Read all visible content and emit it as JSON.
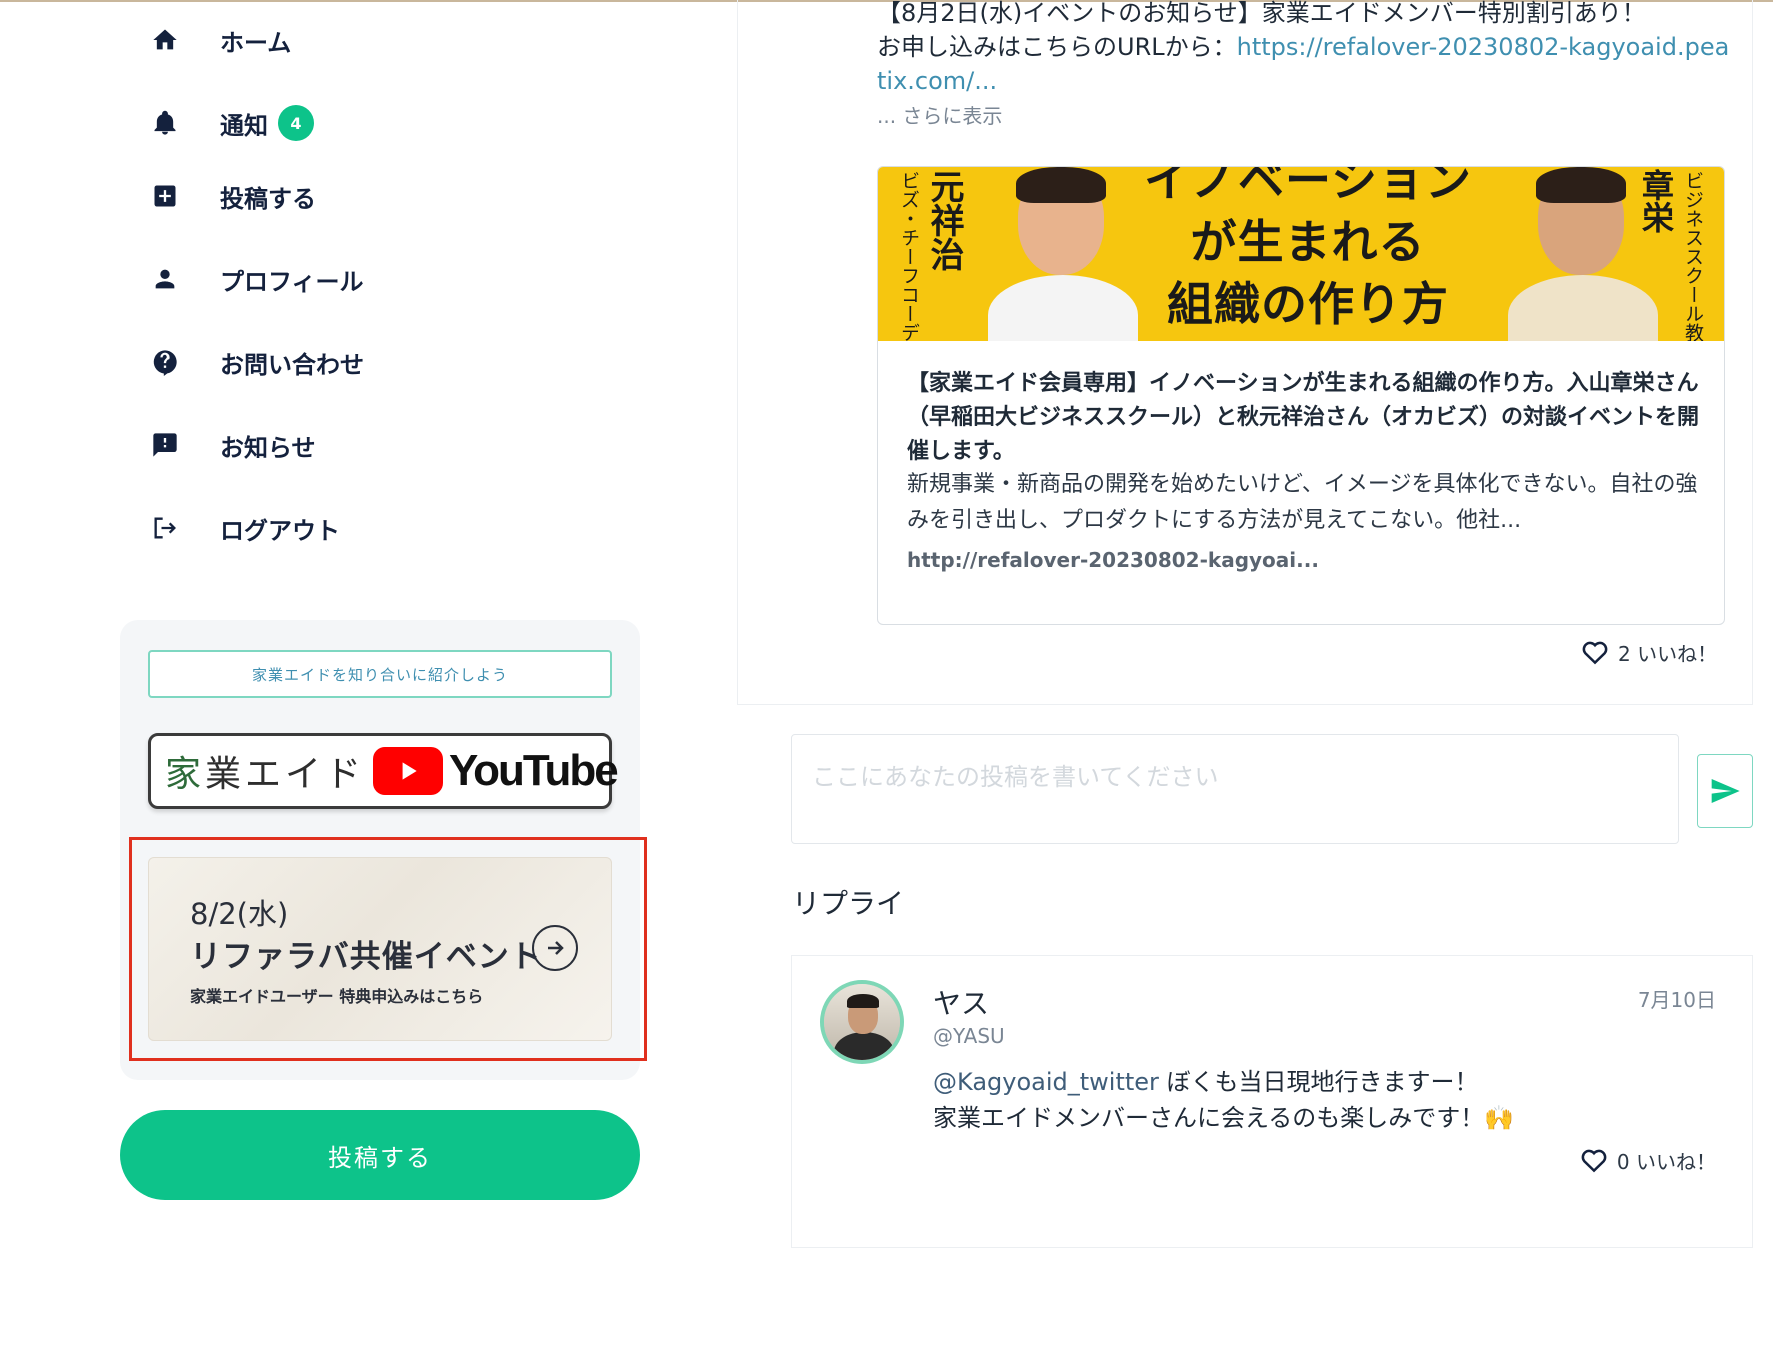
{
  "sidebar": {
    "items": [
      {
        "label": "ホーム",
        "icon": "home-icon"
      },
      {
        "label": "通知",
        "icon": "bell-icon",
        "badge": "4"
      },
      {
        "label": "投稿する",
        "icon": "plus-square-icon"
      },
      {
        "label": "プロフィール",
        "icon": "person-icon"
      },
      {
        "label": "お問い合わせ",
        "icon": "question-icon"
      },
      {
        "label": "お知らせ",
        "icon": "announcement-icon"
      },
      {
        "label": "ログアウト",
        "icon": "logout-icon"
      }
    ],
    "invite_label": "家業エイドを知り合いに紹介しよう",
    "youtube_banner": {
      "brand_first": "家",
      "brand_rest": "業エイド",
      "service": "YouTube"
    },
    "event_banner": {
      "date": "8/2(水)",
      "title": "リファラバ共催イベント",
      "subtitle": "家業エイドユーザー 特典申込みはこちら"
    },
    "post_button": "投稿する"
  },
  "post": {
    "line1": "【8月2日(水)イベントのお知らせ】家業エイドメンバー特別割引あり！",
    "line2_prefix": "お申し込みはこちらのURLから：",
    "line2_link": "https://refalover-20230802-kagyoaid.peatix.com/...",
    "show_more": "... さらに表示",
    "link_card": {
      "thumb_line1": "イノベーション",
      "thumb_line2": "が生まれる",
      "thumb_line3": "組織の作り方",
      "thumb_left_name": "元祥治",
      "thumb_left_role": "ビズ・チーフコーディ",
      "thumb_right_name": "章栄",
      "thumb_right_role": "ビジネススクール教",
      "title": "【家業エイド会員専用】イノベーションが生まれる組織の作り方。入山章栄さん（早稲田大ビジネススクール）と秋元祥治さん（オカビズ）の対談イベントを開催します。",
      "description": "新規事業・新商品の開発を始めたいけど、イメージを具体化できない。自社の強みを引き出し、プロダクトにする方法が見えてこない。他社...",
      "url": "http://refalover-20230802-kagyoai..."
    },
    "likes": "2 いいね！"
  },
  "compose": {
    "placeholder": "ここにあなたの投稿を書いてください"
  },
  "replies": {
    "heading": "リプライ",
    "items": [
      {
        "name": "ヤス",
        "handle": "@YASU",
        "date": "7月10日",
        "mention": "@Kagyoaid_twitter",
        "text1": " ぼくも当日現地行きますー！",
        "text2": "家業エイドメンバーさんに会えるのも楽しみです！🙌",
        "likes": "0 いいね！"
      }
    ]
  },
  "colors": {
    "accent": "#0dc38a",
    "navy": "#14213d",
    "link": "#3f8fb0",
    "highlight": "#e0301e",
    "thumb_yellow": "#f6c60f"
  }
}
